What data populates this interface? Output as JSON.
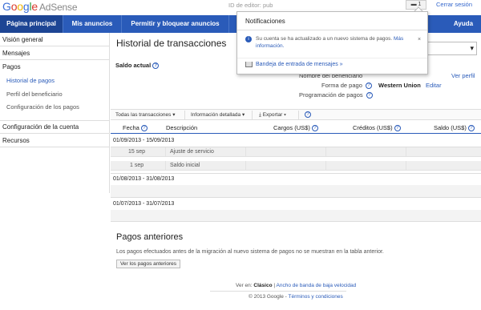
{
  "header": {
    "logo": {
      "g1": "G",
      "g2": "o",
      "g3": "o",
      "g4": "g",
      "g5": "l",
      "g6": "e",
      "product": "AdSense"
    },
    "publisher_id": "ID de editor: pub",
    "notifications_count": "1",
    "sign_out": "Cerrar sesión"
  },
  "nav": {
    "items": [
      "Página principal",
      "Mis anuncios",
      "Permitir y bloquear anuncios",
      "Ayuda"
    ]
  },
  "sidebar": {
    "items": [
      "Visión general",
      "Mensajes",
      "Pagos",
      "Configuración de la cuenta",
      "Recursos"
    ],
    "payments_sub": [
      "Historial de pagos",
      "Perfil del beneficiario",
      "Configuración de los pagos"
    ]
  },
  "main": {
    "title": "Historial de transacciones",
    "balance_label": "Saldo actual",
    "help_glyph": "?",
    "select_arrow": "▾",
    "beneficiary_label": "Nombre del beneficiario",
    "view_profile": "Ver perfil",
    "payment_method_label": "Forma de pago",
    "payment_method_value": "Western Union",
    "edit": "Editar",
    "schedule_label": "Programación de pagos"
  },
  "toolbar": {
    "all_transactions": "Todas las transacciones",
    "detailed_info": "Información detallada",
    "export": "Exportar"
  },
  "table": {
    "headers": [
      "Fecha",
      "Descripción",
      "Cargos (US$)",
      "Créditos (US$)",
      "Saldo (US$)"
    ],
    "periods": [
      "01/09/2013 - 15/09/2013",
      "01/08/2013 - 31/08/2013",
      "01/07/2013 - 31/07/2013"
    ],
    "rows": [
      {
        "date": "15 sep",
        "description": "Ajuste de servicio"
      },
      {
        "date": "1 sep",
        "description": "Saldo inicial"
      }
    ]
  },
  "past": {
    "title": "Pagos anteriores",
    "description": "Los pagos efectuados antes de la migración al nuevo sistema de pagos no se muestran en la tabla anterior.",
    "button": "Ver los pagos anteriores"
  },
  "footer": {
    "view_in": "Ver en:",
    "classic": "Clásico",
    "sep": "|",
    "low_bandwidth": "Ancho de banda de baja velocidad",
    "copyright": "© 2013 Google -",
    "terms": "Términos y condiciones"
  },
  "notification": {
    "title": "Notificaciones",
    "info_glyph": "i",
    "message": "Su cuenta se ha actualizado a un nuevo sistema de pagos.",
    "more_info": "Más información.",
    "close": "×",
    "inbox_link": "Bandeja de entrada de mensajes »"
  },
  "colors": {
    "nav_blue": "#2a5bb9",
    "nav_active": "#1d4594",
    "link": "#2a5bb9"
  }
}
